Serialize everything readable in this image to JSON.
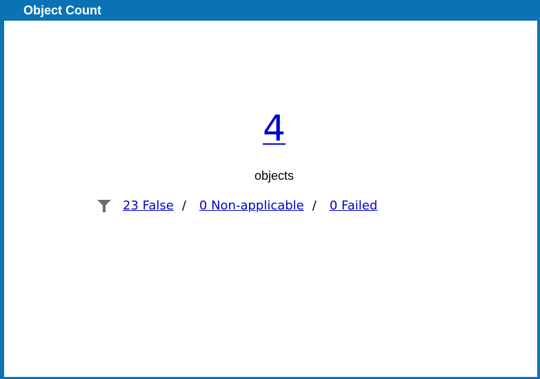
{
  "widget": {
    "title": "Object Count",
    "count": "4",
    "count_label": "objects",
    "filter_icon": "filter-funnel-icon",
    "links": [
      {
        "label": "23 False"
      },
      {
        "label": "0 Non-applicable"
      },
      {
        "label": "0 Failed"
      }
    ],
    "separator": "/"
  },
  "colors": {
    "frame": "#0b72b5",
    "title_text": "#ffffff",
    "link": "#0000cc",
    "icon": "#6b6b6b"
  }
}
